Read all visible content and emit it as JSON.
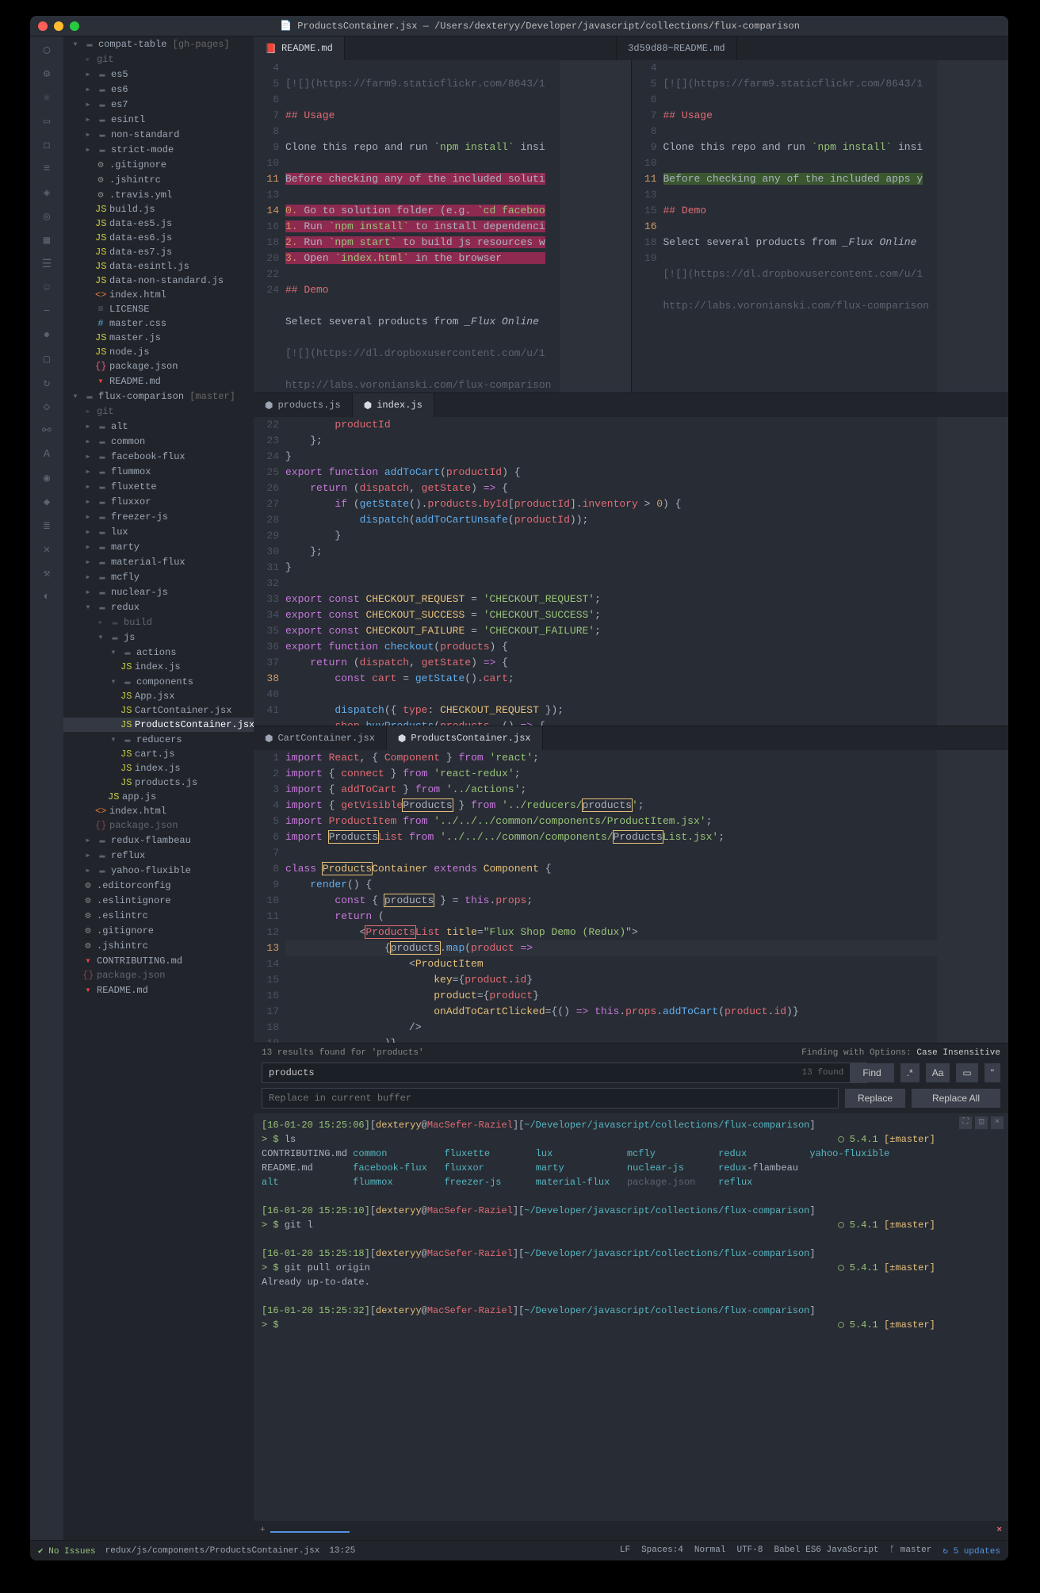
{
  "title": "ProductsContainer.jsx — /Users/dexteryy/Developer/javascript/collections/flux-comparison",
  "sidebar": {
    "projects": [
      {
        "name": "compat-table",
        "branch": "[gh-pages]",
        "icon": "folder",
        "lvl": 0,
        "expand": "▾"
      },
      {
        "name": "git",
        "icon": "git",
        "lvl": 1,
        "expand": "▸",
        "dim": true
      },
      {
        "name": "es5",
        "icon": "folder",
        "lvl": 1,
        "expand": "▸"
      },
      {
        "name": "es6",
        "icon": "folder",
        "lvl": 1,
        "expand": "▸"
      },
      {
        "name": "es7",
        "icon": "folder",
        "lvl": 1,
        "expand": "▸"
      },
      {
        "name": "esintl",
        "icon": "folder",
        "lvl": 1,
        "expand": "▸"
      },
      {
        "name": "non-standard",
        "icon": "folder",
        "lvl": 1,
        "expand": "▸"
      },
      {
        "name": "strict-mode",
        "icon": "folder",
        "lvl": 1,
        "expand": "▸"
      },
      {
        "name": ".gitignore",
        "icon": "cog",
        "lvl": 2
      },
      {
        "name": ".jshintrc",
        "icon": "cog",
        "lvl": 2
      },
      {
        "name": ".travis.yml",
        "icon": "cog",
        "lvl": 2
      },
      {
        "name": "build.js",
        "icon": "js",
        "lvl": 2
      },
      {
        "name": "data-es5.js",
        "icon": "js",
        "lvl": 2
      },
      {
        "name": "data-es6.js",
        "icon": "js",
        "lvl": 2
      },
      {
        "name": "data-es7.js",
        "icon": "js",
        "lvl": 2
      },
      {
        "name": "data-esintl.js",
        "icon": "js",
        "lvl": 2
      },
      {
        "name": "data-non-standard.js",
        "icon": "js",
        "lvl": 2
      },
      {
        "name": "index.html",
        "icon": "html",
        "lvl": 2
      },
      {
        "name": "LICENSE",
        "icon": "file",
        "lvl": 2
      },
      {
        "name": "master.css",
        "icon": "css",
        "lvl": 2
      },
      {
        "name": "master.js",
        "icon": "js",
        "lvl": 2
      },
      {
        "name": "node.js",
        "icon": "js",
        "lvl": 2
      },
      {
        "name": "package.json",
        "icon": "json",
        "lvl": 2
      },
      {
        "name": "README.md",
        "icon": "md",
        "lvl": 2
      },
      {
        "name": "flux-comparison",
        "branch": "[master]",
        "icon": "folder",
        "lvl": 0,
        "expand": "▾"
      },
      {
        "name": "git",
        "icon": "git",
        "lvl": 1,
        "expand": "▸",
        "dim": true
      },
      {
        "name": "alt",
        "icon": "folder",
        "lvl": 1,
        "expand": "▸"
      },
      {
        "name": "common",
        "icon": "folder",
        "lvl": 1,
        "expand": "▸"
      },
      {
        "name": "facebook-flux",
        "icon": "folder",
        "lvl": 1,
        "expand": "▸"
      },
      {
        "name": "flummox",
        "icon": "folder",
        "lvl": 1,
        "expand": "▸"
      },
      {
        "name": "fluxette",
        "icon": "folder",
        "lvl": 1,
        "expand": "▸"
      },
      {
        "name": "fluxxor",
        "icon": "folder",
        "lvl": 1,
        "expand": "▸"
      },
      {
        "name": "freezer-js",
        "icon": "folder",
        "lvl": 1,
        "expand": "▸"
      },
      {
        "name": "lux",
        "icon": "folder",
        "lvl": 1,
        "expand": "▸"
      },
      {
        "name": "marty",
        "icon": "folder",
        "lvl": 1,
        "expand": "▸"
      },
      {
        "name": "material-flux",
        "icon": "folder",
        "lvl": 1,
        "expand": "▸"
      },
      {
        "name": "mcfly",
        "icon": "folder",
        "lvl": 1,
        "expand": "▸"
      },
      {
        "name": "nuclear-js",
        "icon": "folder",
        "lvl": 1,
        "expand": "▸"
      },
      {
        "name": "redux",
        "icon": "folder",
        "lvl": 1,
        "expand": "▾"
      },
      {
        "name": "build",
        "icon": "folder",
        "lvl": 2,
        "expand": "▸",
        "dim": true
      },
      {
        "name": "js",
        "icon": "folder",
        "lvl": 2,
        "expand": "▾"
      },
      {
        "name": "actions",
        "icon": "folder",
        "lvl": 3,
        "expand": "▾"
      },
      {
        "name": "index.js",
        "icon": "js",
        "lvl": 4
      },
      {
        "name": "components",
        "icon": "folder",
        "lvl": 3,
        "expand": "▾"
      },
      {
        "name": "App.jsx",
        "icon": "js",
        "lvl": 4
      },
      {
        "name": "CartContainer.jsx",
        "icon": "js",
        "lvl": 4
      },
      {
        "name": "ProductsContainer.jsx",
        "icon": "js",
        "lvl": 4,
        "selected": true
      },
      {
        "name": "reducers",
        "icon": "folder",
        "lvl": 3,
        "expand": "▾"
      },
      {
        "name": "cart.js",
        "icon": "js",
        "lvl": 4
      },
      {
        "name": "index.js",
        "icon": "js",
        "lvl": 4
      },
      {
        "name": "products.js",
        "icon": "js",
        "lvl": 4
      },
      {
        "name": "app.js",
        "icon": "js",
        "lvl": 3
      },
      {
        "name": "index.html",
        "icon": "html",
        "lvl": 2
      },
      {
        "name": "package.json",
        "icon": "json",
        "lvl": 2,
        "dim": true
      },
      {
        "name": "redux-flambeau",
        "icon": "folder",
        "lvl": 1,
        "expand": "▸"
      },
      {
        "name": "reflux",
        "icon": "folder",
        "lvl": 1,
        "expand": "▸"
      },
      {
        "name": "yahoo-fluxible",
        "icon": "folder",
        "lvl": 1,
        "expand": "▸"
      },
      {
        "name": ".editorconfig",
        "icon": "cog",
        "lvl": 1
      },
      {
        "name": ".eslintignore",
        "icon": "cog",
        "lvl": 1
      },
      {
        "name": ".eslintrc",
        "icon": "cog",
        "lvl": 1
      },
      {
        "name": ".gitignore",
        "icon": "cog",
        "lvl": 1
      },
      {
        "name": ".jshintrc",
        "icon": "cog",
        "lvl": 1
      },
      {
        "name": "CONTRIBUTING.md",
        "icon": "md",
        "lvl": 1
      },
      {
        "name": "package.json",
        "icon": "json",
        "lvl": 1,
        "dim": true
      },
      {
        "name": "README.md",
        "icon": "md",
        "lvl": 1
      }
    ]
  },
  "pane1": {
    "tabs": [
      {
        "label": "README.md",
        "active": true,
        "icon": "md"
      },
      {
        "label": "3d59d88~README.md",
        "active": false,
        "spacer": true
      }
    ]
  },
  "pane2": {
    "tabs": [
      {
        "label": "products.js",
        "active": false,
        "icon": "js"
      },
      {
        "label": "index.js",
        "active": true,
        "icon": "js"
      }
    ]
  },
  "pane3": {
    "tabs": [
      {
        "label": "CartContainer.jsx",
        "active": false,
        "icon": "js"
      },
      {
        "label": "ProductsContainer.jsx",
        "active": true,
        "icon": "js"
      }
    ]
  },
  "search": {
    "results_text": "13 results found for 'products'",
    "opts_label": "Finding with Options:",
    "opts_value": "Case Insensitive",
    "query": "products",
    "count": "13 found",
    "find": "Find",
    "replace_ph": "Replace in current buffer",
    "replace": "Replace",
    "replace_all": "Replace All"
  },
  "terminal": {
    "rows": [
      "[16-01-20 15:25:06][dexteryy@MacSefer-Raziel][~/Developer/javascript/collections/flux-comparison]",
      "> $ ls                                                                                               ◯ 5.4.1 [±master]",
      "CONTRIBUTING.md common          fluxette        lux             mcfly           redux           yahoo-fluxible",
      "README.md       facebook-flux   fluxxor         marty           nuclear-js      redux-flambeau",
      "alt             flummox         freezer-js      material-flux   package.json    reflux",
      "",
      "[16-01-20 15:25:10][dexteryy@MacSefer-Raziel][~/Developer/javascript/collections/flux-comparison]",
      "> $ git l                                                                                            ◯ 5.4.1 [±master]",
      "",
      "[16-01-20 15:25:18][dexteryy@MacSefer-Raziel][~/Developer/javascript/collections/flux-comparison]",
      "> $ git pull origin                                                                                  ◯ 5.4.1 [±master]",
      "Already up-to-date.",
      "",
      "[16-01-20 15:25:32][dexteryy@MacSefer-Raziel][~/Developer/javascript/collections/flux-comparison]",
      "> $                                                                                                  ◯ 5.4.1 [±master]"
    ]
  },
  "footer_tab": {
    "plus": "+",
    "x": "×"
  },
  "status": {
    "issues": "No Issues",
    "path": "redux/js/components/ProductsContainer.jsx",
    "pos": "13:25",
    "lf": "LF",
    "spaces": "Spaces:4",
    "mode": "Normal",
    "enc": "UTF-8",
    "lang": "Babel ES6 JavaScript",
    "branch": "master",
    "updates": "5 updates"
  }
}
